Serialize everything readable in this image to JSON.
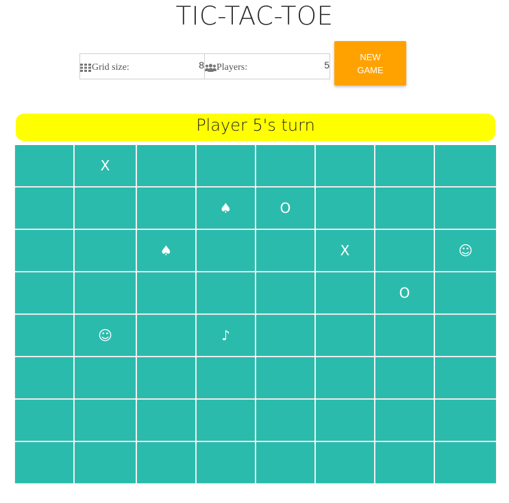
{
  "title": "TIC-TAC-TOE",
  "controls": {
    "grid_size_label": "Grid size:",
    "grid_size_value": "8",
    "players_label": "Players:",
    "players_value": "5",
    "new_game_line1": "NEW",
    "new_game_line2": "GAME"
  },
  "status": {
    "turn_text": "Player 5's turn"
  },
  "board": {
    "rows": 8,
    "cols": 8,
    "cells": [
      [
        "",
        "X",
        "",
        "",
        "",
        "",
        "",
        ""
      ],
      [
        "",
        "",
        "",
        "♠",
        "O",
        "",
        "",
        ""
      ],
      [
        "",
        "",
        "♠",
        "",
        "",
        "X",
        "",
        "☺"
      ],
      [
        "",
        "",
        "",
        "",
        "",
        "",
        "O",
        ""
      ],
      [
        "",
        "☺",
        "",
        "♪",
        "",
        "",
        "",
        ""
      ],
      [
        "",
        "",
        "",
        "",
        "",
        "",
        "",
        ""
      ],
      [
        "",
        "",
        "",
        "",
        "",
        "",
        "",
        ""
      ],
      [
        "",
        "",
        "",
        "",
        "",
        "",
        "",
        ""
      ]
    ]
  },
  "colors": {
    "cell": "#2bbbad",
    "banner": "#ffff00",
    "button": "#ffa200",
    "icon": "#757575"
  },
  "icons": {
    "grid_size": "grid-icon",
    "players": "users-icon"
  }
}
